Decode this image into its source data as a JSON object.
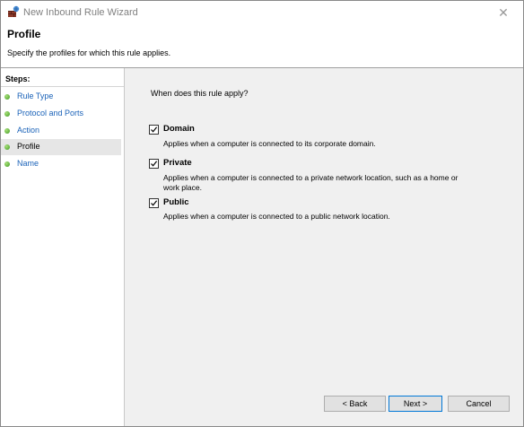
{
  "window": {
    "title": "New Inbound Rule Wizard",
    "close_glyph": "✕"
  },
  "header": {
    "title": "Profile",
    "subtitle": "Specify the profiles for which this rule applies."
  },
  "sidebar": {
    "steps_label": "Steps:",
    "items": [
      {
        "label": "Rule Type",
        "current": false
      },
      {
        "label": "Protocol and Ports",
        "current": false
      },
      {
        "label": "Action",
        "current": false
      },
      {
        "label": "Profile",
        "current": true
      },
      {
        "label": "Name",
        "current": false
      }
    ]
  },
  "main": {
    "question": "When does this rule apply?",
    "options": [
      {
        "label": "Domain",
        "checked": true,
        "description": "Applies when a computer is connected to its corporate domain."
      },
      {
        "label": "Private",
        "checked": true,
        "description": "Applies when a computer is connected to a private network location, such as a home or work place."
      },
      {
        "label": "Public",
        "checked": true,
        "description": "Applies when a computer is connected to a public network location."
      }
    ]
  },
  "footer": {
    "back_label": "< Back",
    "next_label": "Next >",
    "cancel_label": "Cancel"
  },
  "colors": {
    "link": "#1a62b8",
    "content_bg": "#f0f0f0",
    "step_dot": "#3d9a1e",
    "default_button_border": "#0078d7"
  }
}
